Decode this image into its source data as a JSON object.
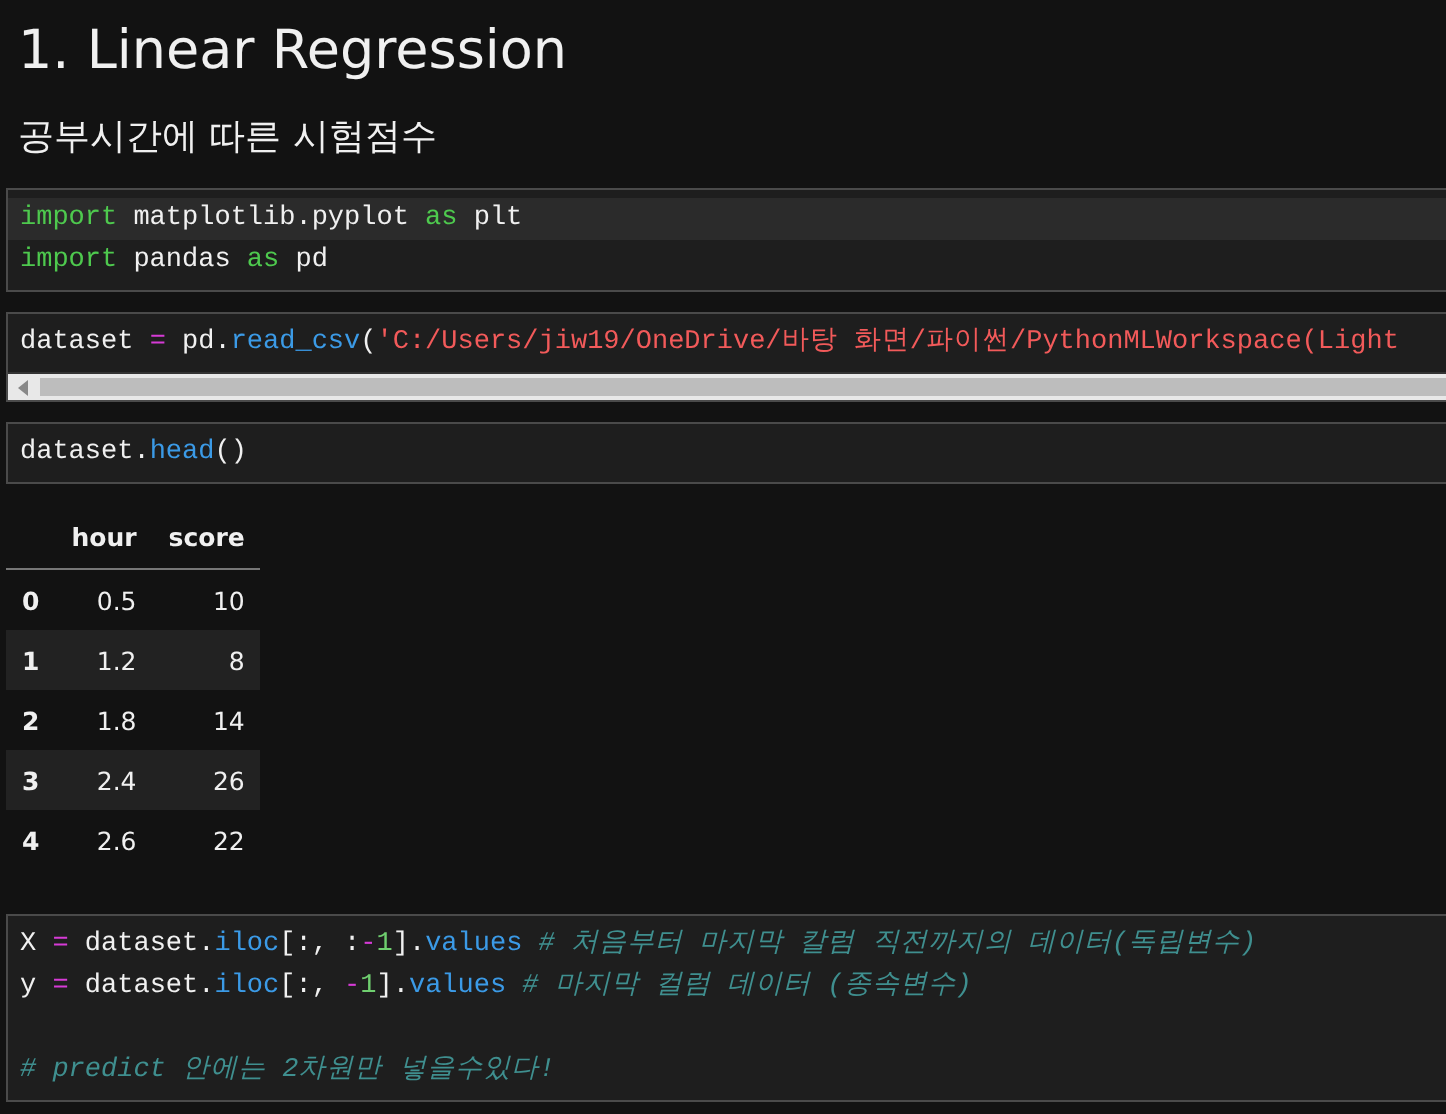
{
  "heading": "1. Linear Regression",
  "subheading": "공부시간에 따른 시험점수",
  "cells": [
    {
      "kind": "code",
      "lines": [
        {
          "active": true,
          "tokens": [
            {
              "kind": "keyword",
              "text": "import"
            },
            {
              "kind": "plain",
              "text": " matplotlib.pyplot "
            },
            {
              "kind": "keyword",
              "text": "as"
            },
            {
              "kind": "plain",
              "text": " plt"
            }
          ]
        },
        {
          "active": false,
          "tokens": [
            {
              "kind": "keyword",
              "text": "import"
            },
            {
              "kind": "plain",
              "text": " pandas "
            },
            {
              "kind": "keyword",
              "text": "as"
            },
            {
              "kind": "plain",
              "text": " pd"
            }
          ]
        }
      ]
    },
    {
      "kind": "code",
      "scrollbar": true,
      "lines": [
        {
          "tokens": [
            {
              "kind": "plain",
              "text": "dataset "
            },
            {
              "kind": "operator",
              "text": "="
            },
            {
              "kind": "plain",
              "text": " pd."
            },
            {
              "kind": "function",
              "text": "read_csv"
            },
            {
              "kind": "plain",
              "text": "("
            },
            {
              "kind": "string",
              "text": "'C:/Users/jiw19/OneDrive/바탕 화면/파이썬/PythonMLWorkspace(Light"
            }
          ]
        }
      ]
    },
    {
      "kind": "code",
      "lines": [
        {
          "tokens": [
            {
              "kind": "plain",
              "text": "dataset."
            },
            {
              "kind": "function",
              "text": "head"
            },
            {
              "kind": "plain",
              "text": "()"
            }
          ]
        }
      ]
    },
    {
      "kind": "table",
      "columns": [
        "hour",
        "score"
      ],
      "rows": [
        {
          "index": "0",
          "values": [
            "0.5",
            "10"
          ]
        },
        {
          "index": "1",
          "values": [
            "1.2",
            "8"
          ]
        },
        {
          "index": "2",
          "values": [
            "1.8",
            "14"
          ]
        },
        {
          "index": "3",
          "values": [
            "2.4",
            "26"
          ]
        },
        {
          "index": "4",
          "values": [
            "2.6",
            "22"
          ]
        }
      ]
    },
    {
      "kind": "code",
      "lines": [
        {
          "tokens": [
            {
              "kind": "plain",
              "text": "X "
            },
            {
              "kind": "operator",
              "text": "="
            },
            {
              "kind": "plain",
              "text": " dataset."
            },
            {
              "kind": "function",
              "text": "iloc"
            },
            {
              "kind": "plain",
              "text": "[:, :"
            },
            {
              "kind": "operator",
              "text": "-"
            },
            {
              "kind": "number",
              "text": "1"
            },
            {
              "kind": "plain",
              "text": "]."
            },
            {
              "kind": "function",
              "text": "values"
            },
            {
              "kind": "comment",
              "text": " # 처음부터 마지막 칼럼 직전까지의 데이터(독립변수)"
            }
          ]
        },
        {
          "tokens": [
            {
              "kind": "plain",
              "text": "y "
            },
            {
              "kind": "operator",
              "text": "="
            },
            {
              "kind": "plain",
              "text": " dataset."
            },
            {
              "kind": "function",
              "text": "iloc"
            },
            {
              "kind": "plain",
              "text": "[:, "
            },
            {
              "kind": "operator",
              "text": "-"
            },
            {
              "kind": "number",
              "text": "1"
            },
            {
              "kind": "plain",
              "text": "]."
            },
            {
              "kind": "function",
              "text": "values"
            },
            {
              "kind": "comment",
              "text": " # 마지막 컬럼 데이터 (종속변수)"
            }
          ]
        },
        {
          "kind": "blank"
        },
        {
          "tokens": [
            {
              "kind": "comment",
              "text": "# predict 안에는 2차원만 넣을수있다!"
            }
          ]
        }
      ]
    }
  ]
}
